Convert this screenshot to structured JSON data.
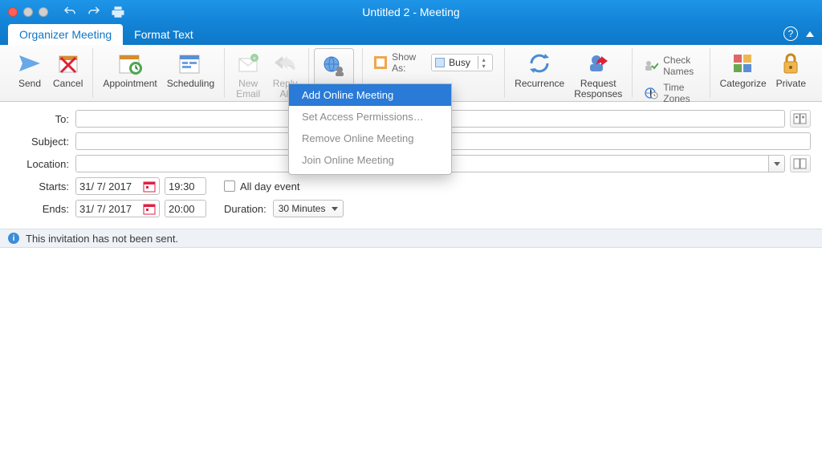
{
  "window": {
    "title": "Untitled 2 - Meeting"
  },
  "tabs": {
    "organizer": "Organizer Meeting",
    "format": "Format Text"
  },
  "ribbon": {
    "send": "Send",
    "cancel": "Cancel",
    "appointment": "Appointment",
    "scheduling": "Scheduling",
    "new_email": "New\nEmail",
    "reply_all": "Reply\nAll",
    "show_as_label": "Show As:",
    "show_as_value": "Busy",
    "recurrence": "Recurrence",
    "request_responses": "Request\nResponses",
    "check_names": "Check Names",
    "time_zones": "Time Zones",
    "categorize": "Categorize",
    "private": "Private"
  },
  "online_menu": {
    "add": "Add Online Meeting",
    "permissions": "Set Access Permissions…",
    "remove": "Remove Online Meeting",
    "join": "Join Online Meeting"
  },
  "fields": {
    "to": "To:",
    "subject": "Subject:",
    "location": "Location:",
    "starts": "Starts:",
    "ends": "Ends:",
    "date_start": "31/ 7/ 2017",
    "date_end": "31/ 7/ 2017",
    "time_start": "19:30",
    "time_end": "20:00",
    "all_day": "All day event",
    "duration_label": "Duration:",
    "duration_value": "30 Minutes"
  },
  "info": {
    "not_sent": "This invitation has not been sent."
  }
}
